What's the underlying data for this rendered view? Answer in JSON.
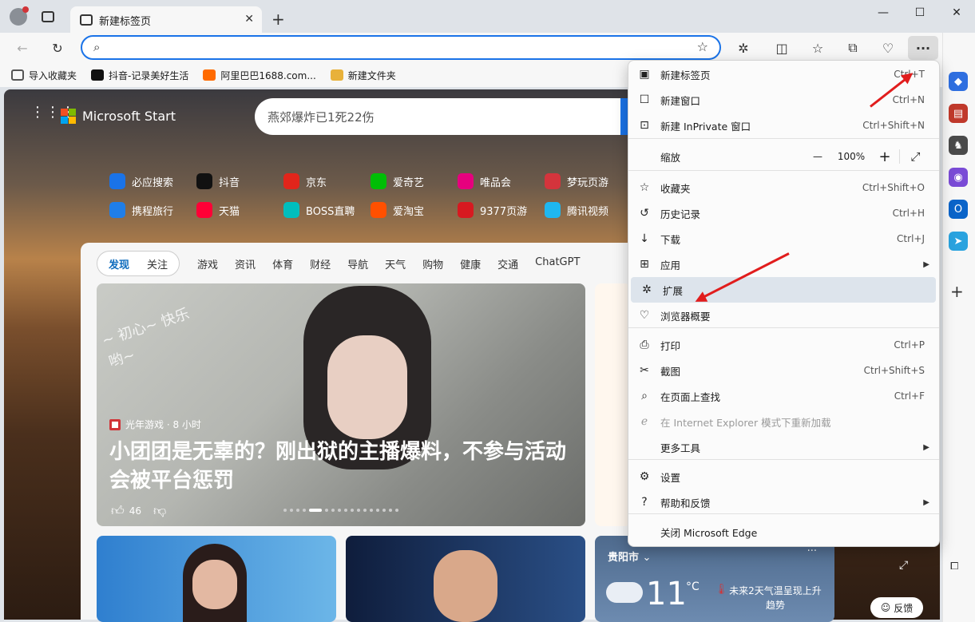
{
  "window": {
    "tab_title": "新建标签页"
  },
  "favorites": [
    {
      "label": "导入收藏夹",
      "color": "#555555"
    },
    {
      "label": "抖音-记录美好生活",
      "color": "#111111"
    },
    {
      "label": "阿里巴巴1688.com...",
      "color": "#ff6a00"
    },
    {
      "label": "新建文件夹",
      "color": "#e8b13a"
    }
  ],
  "page": {
    "brand": "Microsoft Start",
    "search_placeholder": "燕郊爆炸已1死22伤",
    "quicklinks_row1": [
      {
        "label": "必应搜索",
        "icon": "search-icon",
        "color": "#1a73e8"
      },
      {
        "label": "抖音",
        "icon": "douyin-icon",
        "color": "#111111"
      },
      {
        "label": "京东",
        "icon": "jd-icon",
        "color": "#e1251b"
      },
      {
        "label": "爱奇艺",
        "icon": "iqiyi-icon",
        "color": "#00be06"
      },
      {
        "label": "唯品会",
        "icon": "vip-icon",
        "color": "#e6007e"
      },
      {
        "label": "梦玩页游",
        "icon": "game-icon",
        "color": "#d4343c"
      }
    ],
    "quicklinks_row2": [
      {
        "label": "携程旅行",
        "icon": "ctrip-icon",
        "color": "#1f7ee8"
      },
      {
        "label": "天猫",
        "icon": "tmall-icon",
        "color": "#ff0036"
      },
      {
        "label": "BOSS直聘",
        "icon": "boss-icon",
        "color": "#00bebd"
      },
      {
        "label": "爱淘宝",
        "icon": "taobao-icon",
        "color": "#ff5000"
      },
      {
        "label": "9377页游",
        "icon": "game9377-icon",
        "color": "#d71920"
      },
      {
        "label": "腾讯视频",
        "icon": "tencent-video-icon",
        "color": "#1fb7f0"
      }
    ],
    "feed_tabs": {
      "active": "发现",
      "follow": "关注",
      "items": [
        "游戏",
        "资讯",
        "体育",
        "财经",
        "导航",
        "天气",
        "购物",
        "健康",
        "交通",
        "ChatGPT"
      ]
    },
    "hero": {
      "source": "光年游戏 · 8 小时",
      "title": "小团团是无辜的？刚出狱的主播爆料，不参与活动会被平台惩罚",
      "likes": "46",
      "overlay_text": "~ 初心~ 快乐哟~"
    },
    "weather": {
      "city": "贵阳市",
      "temp": "11",
      "unit": "°C",
      "note": "未来2天气温呈现上升趋势"
    },
    "feedback": "反馈"
  },
  "menu": {
    "items": [
      {
        "id": "new-tab",
        "icon": "new-tab-icon",
        "glyph": "▣",
        "label": "新建标签页",
        "shortcut": "Ctrl+T"
      },
      {
        "id": "new-window",
        "icon": "new-window-icon",
        "glyph": "☐",
        "label": "新建窗口",
        "shortcut": "Ctrl+N"
      },
      {
        "id": "inprivate",
        "icon": "inprivate-icon",
        "glyph": "⊡",
        "label": "新建 InPrivate 窗口",
        "shortcut": "Ctrl+Shift+N"
      },
      {
        "id": "zoom",
        "label": "缩放",
        "value": "100%"
      },
      {
        "id": "favorites",
        "icon": "star-list-icon",
        "glyph": "☆",
        "label": "收藏夹",
        "shortcut": "Ctrl+Shift+O"
      },
      {
        "id": "history",
        "icon": "history-icon",
        "glyph": "↺",
        "label": "历史记录",
        "shortcut": "Ctrl+H"
      },
      {
        "id": "downloads",
        "icon": "download-icon",
        "glyph": "↓",
        "label": "下载",
        "shortcut": "Ctrl+J"
      },
      {
        "id": "apps",
        "icon": "apps-icon",
        "glyph": "⊞",
        "label": "应用",
        "submenu": true
      },
      {
        "id": "extensions",
        "icon": "puzzle-icon",
        "glyph": "✲",
        "label": "扩展"
      },
      {
        "id": "essentials",
        "icon": "heartbeat-icon",
        "glyph": "♡",
        "label": "浏览器概要"
      },
      {
        "id": "print",
        "icon": "print-icon",
        "glyph": "⎙",
        "label": "打印",
        "shortcut": "Ctrl+P"
      },
      {
        "id": "screenshot",
        "icon": "screenshot-icon",
        "glyph": "✂",
        "label": "截图",
        "shortcut": "Ctrl+Shift+S"
      },
      {
        "id": "find",
        "icon": "find-icon",
        "glyph": "⌕",
        "label": "在页面上查找",
        "shortcut": "Ctrl+F"
      },
      {
        "id": "ie-mode",
        "icon": "ie-icon",
        "glyph": "ℯ",
        "label": "在 Internet Explorer 模式下重新加载",
        "disabled": true
      },
      {
        "id": "more-tools",
        "label": "更多工具",
        "submenu": true
      },
      {
        "id": "settings",
        "icon": "gear-icon",
        "glyph": "⚙",
        "label": "设置"
      },
      {
        "id": "help",
        "icon": "help-icon",
        "glyph": "?",
        "label": "帮助和反馈",
        "submenu": true
      },
      {
        "id": "close",
        "label": "关闭 Microsoft Edge"
      }
    ]
  }
}
